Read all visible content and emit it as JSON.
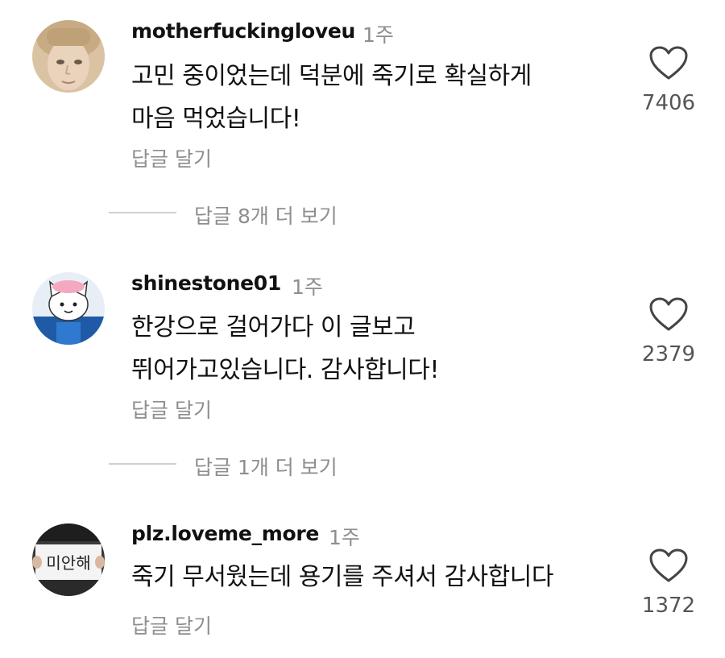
{
  "comments": [
    {
      "username": "motherfuckingloveu",
      "time": "1주",
      "lines": [
        "고민 중이었는데 덕분에 죽기로 확실하게",
        "마음 먹었습니다!"
      ],
      "reply_label": "답글 달기",
      "likes": "7406",
      "more_replies": "답글 8개 더 보기",
      "avatar_icon": "child-face-avatar"
    },
    {
      "username": "shinestone01",
      "time": "1주",
      "lines": [
        "한강으로 걸어가다 이 글보고",
        "뛰어가고있습니다. 감사합니다!"
      ],
      "reply_label": "답글 달기",
      "likes": "2379",
      "more_replies": "답글 1개 더 보기",
      "avatar_icon": "cartoon-cat-avatar"
    },
    {
      "username": "plz.loveme_more",
      "time": "1주",
      "lines": [
        "죽기 무서웠는데 용기를 주셔서 감사합니다"
      ],
      "reply_label": "답글 달기",
      "likes": "1372",
      "avatar_icon": "sign-holding-avatar",
      "avatar_sign_text": "미안해"
    }
  ],
  "colors": {
    "text": "#111111",
    "muted": "#8e8e8e",
    "divider": "#d0d0d0"
  }
}
